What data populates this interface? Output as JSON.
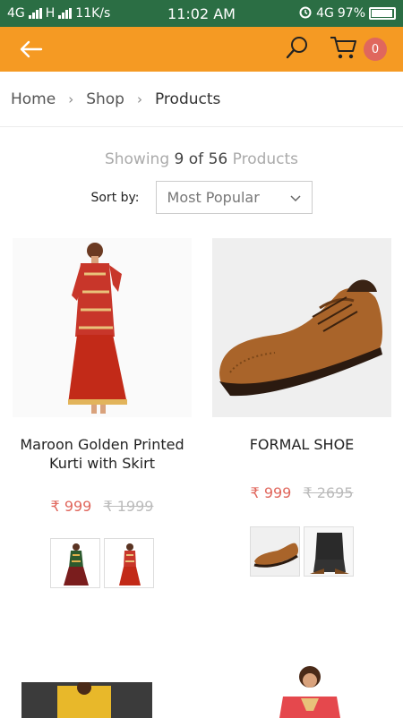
{
  "status_bar": {
    "network_left": "4G",
    "network_h": "H",
    "speed": "11K/s",
    "time": "11:02 AM",
    "network_right": "4G",
    "battery": "97%"
  },
  "app_bar": {
    "back_icon": "arrow-left-icon",
    "search_icon": "search-icon",
    "cart_icon": "cart-icon",
    "cart_count": "0",
    "colors": {
      "bar": "#f59a23",
      "badge": "#e0675d"
    }
  },
  "breadcrumb": {
    "items": [
      "Home",
      "Shop"
    ],
    "current": "Products"
  },
  "listing": {
    "showing_prefix": "Showing",
    "shown": "9",
    "of_word": "of",
    "total": "56",
    "suffix": "Products",
    "sort_label": "Sort by:",
    "sort_value": "Most Popular"
  },
  "products": [
    {
      "title": "Maroon Golden Printed Kurti with Skirt",
      "price": "₹ 999",
      "original_price": "₹ 1999"
    },
    {
      "title": "FORMAL SHOE",
      "price": "₹ 999",
      "original_price": "₹ 2695"
    }
  ],
  "accent_color": "#e0675d"
}
